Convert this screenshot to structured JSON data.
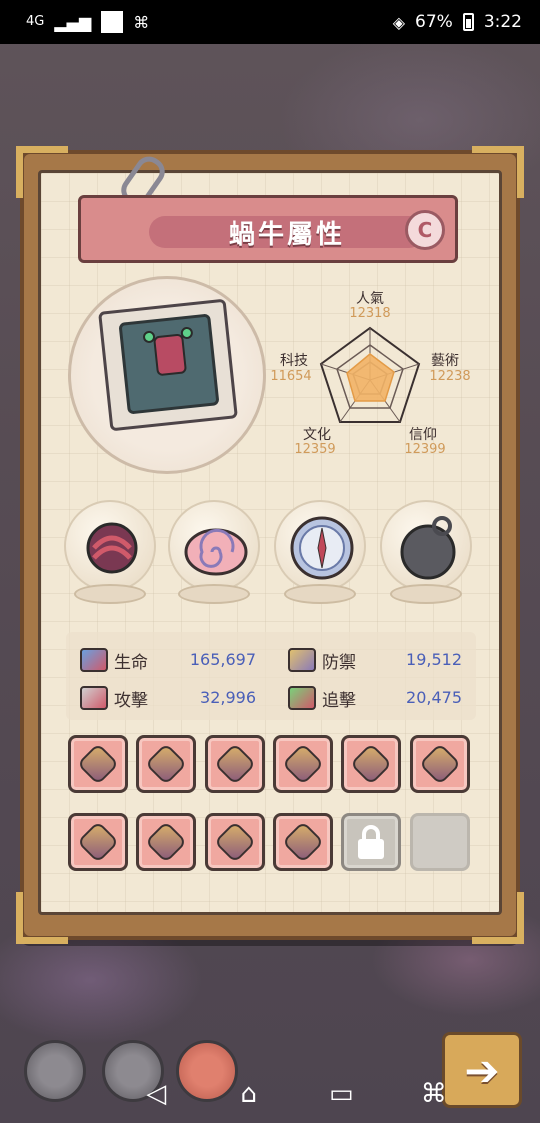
{
  "status_bar": {
    "network": "4G",
    "battery": "67%",
    "time": "3:22"
  },
  "panel": {
    "title": "蝸牛屬性",
    "grade": "C"
  },
  "radar": {
    "attributes": [
      {
        "label": "人氣",
        "value": "12318"
      },
      {
        "label": "藝術",
        "value": "12238"
      },
      {
        "label": "信仰",
        "value": "12399"
      },
      {
        "label": "文化",
        "value": "12359"
      },
      {
        "label": "科技",
        "value": "11654"
      }
    ]
  },
  "relics": [
    "tentacle-relic-icon",
    "shell-relic-icon",
    "compass-relic-icon",
    "bomb-relic-icon"
  ],
  "stats": {
    "hp": {
      "label": "生命",
      "value": "165,697"
    },
    "defense": {
      "label": "防禦",
      "value": "19,512"
    },
    "attack": {
      "label": "攻擊",
      "value": "32,996"
    },
    "pursuit": {
      "label": "追擊",
      "value": "20,475"
    }
  },
  "equipment": {
    "row1": [
      "armor-icon",
      "mace-icon",
      "sword-icon",
      "gauntlet-icon",
      "shield-icon",
      "staff-icon"
    ],
    "row2": [
      "scythe-icon",
      "crossed-swords-icon",
      "crown-icon",
      "amulet-icon",
      "lock-icon",
      "empty-slot"
    ]
  },
  "colors": {
    "banner": "#d98c8c",
    "slot": "#f0a8a0",
    "stat_value": "#4a5fb8",
    "radar_value": "#d09a5a"
  }
}
